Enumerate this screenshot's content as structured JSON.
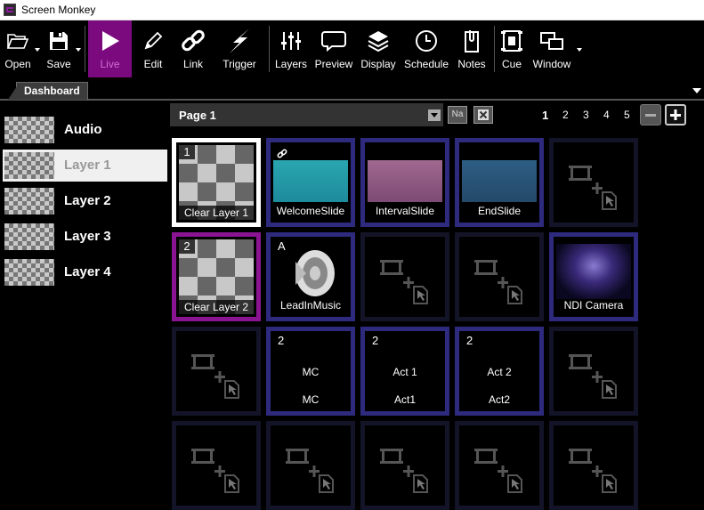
{
  "window": {
    "title": "Screen Monkey"
  },
  "toolbar": {
    "open": "Open",
    "save": "Save",
    "live": "Live",
    "edit": "Edit",
    "link": "Link",
    "trigger": "Trigger",
    "layers": "Layers",
    "preview": "Preview",
    "display": "Display",
    "schedule": "Schedule",
    "notes": "Notes",
    "cue": "Cue",
    "window": "Window"
  },
  "tabs": {
    "dashboard": "Dashboard"
  },
  "layers": [
    "Audio",
    "Layer 1",
    "Layer 2",
    "Layer 3",
    "Layer 4"
  ],
  "selected_layer": "Layer 1",
  "pagebar": {
    "page": "Page 1",
    "name_button": "Na",
    "pages": [
      "1",
      "2",
      "3",
      "4",
      "5"
    ],
    "current_page": "1"
  },
  "cues": {
    "r1c1": {
      "badge": "1",
      "name": "Clear Layer 1"
    },
    "r1c2": {
      "name": "WelcomeSlide"
    },
    "r1c3": {
      "name": "IntervalSlide"
    },
    "r1c4": {
      "name": "EndSlide"
    },
    "r2c1": {
      "badge": "2",
      "name": "Clear Layer 2"
    },
    "r2c2": {
      "badge": "A",
      "name": "LeadInMusic"
    },
    "r2c6": {
      "name": "NDI Camera"
    },
    "r3c2": {
      "num": "2",
      "text": "MC",
      "name": "MC"
    },
    "r3c3": {
      "num": "2",
      "text": "Act 1",
      "name": "Act1"
    },
    "r3c4": {
      "num": "2",
      "text": "Act 2",
      "name": "Act2"
    }
  },
  "colors": {
    "live_accent": "#7b0a7f",
    "cue_border_assigned": "#2e2a7e",
    "cue_border_empty": "#141428",
    "cue_border_selected": "#ffffff",
    "cue_border_layer2": "#8a1491"
  }
}
